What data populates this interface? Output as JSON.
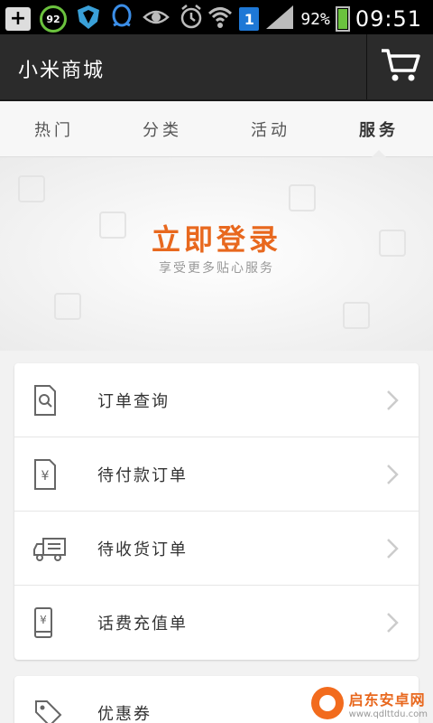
{
  "status_bar": {
    "plus_label": "+",
    "badge_value": "92",
    "notification_count": "1",
    "battery_percent": "92%",
    "battery_level": 0.92,
    "time": "09:51"
  },
  "app": {
    "title": "小米商城"
  },
  "tabs": [
    {
      "label": "热门"
    },
    {
      "label": "分类"
    },
    {
      "label": "活动"
    },
    {
      "label": "服务"
    }
  ],
  "login": {
    "title": "立即登录",
    "subtitle": "享受更多贴心服务"
  },
  "menu": [
    {
      "label": "订单查询",
      "icon": "order-search-icon"
    },
    {
      "label": "待付款订单",
      "icon": "yuan-document-icon"
    },
    {
      "label": "待收货订单",
      "icon": "delivery-truck-icon"
    },
    {
      "label": "话费充值单",
      "icon": "phone-yuan-icon"
    }
  ],
  "menu2": [
    {
      "label": "优惠券",
      "icon": "coupon-tag-icon"
    }
  ],
  "watermark": {
    "name": "启东安卓网",
    "url": "www.qdlttdu.com"
  },
  "colors": {
    "accent": "#e8681e",
    "titlebar": "#2b2b2b",
    "battery": "#6bc23e"
  }
}
